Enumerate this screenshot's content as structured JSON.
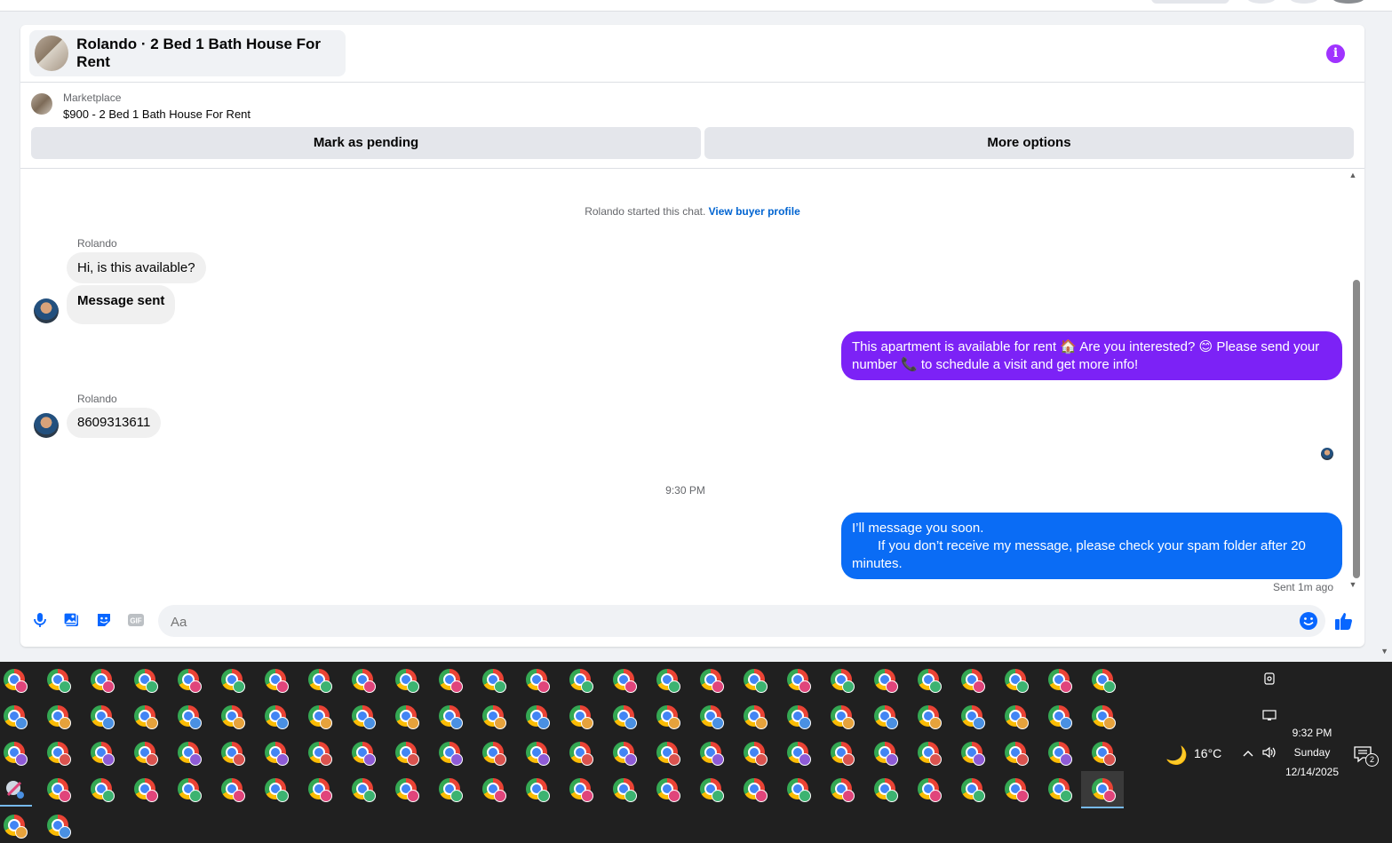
{
  "chat": {
    "title": "Rolando · 2 Bed 1 Bath House For Rent",
    "listing": {
      "source": "Marketplace",
      "price_title": "$900 - 2 Bed 1 Bath House For Rent"
    },
    "actions": {
      "mark_pending": "Mark as pending",
      "more_options": "More options"
    },
    "started_text": "Rolando started this chat.",
    "view_buyer_profile": "View buyer profile",
    "messages": [
      {
        "sender": "Rolando",
        "text": "Hi, is this available?"
      },
      {
        "text": "Message sent"
      },
      {
        "sender": "me",
        "text": "This apartment is available for rent 🏠 Are you interested? 😊 Please send your number 📞 to schedule a visit and get more info!"
      },
      {
        "sender": "Rolando",
        "text": "8609313611"
      },
      {
        "sender": "me",
        "line1": "I’ll message you soon.",
        "line2": "If you don’t receive my message, please check your spam folder after 20",
        "line3": "minutes."
      }
    ],
    "timestamp": "9:30 PM",
    "sent_status": "Sent 1m ago",
    "composer": {
      "placeholder": "Aa",
      "value": ""
    },
    "colors": {
      "purple_bubble": "#7c22f6",
      "blue_bubble": "#0a6cf5",
      "accent": "#0084ff",
      "info": "#a033ff"
    }
  },
  "taskbar": {
    "weather_temp": "16°C",
    "clock_time": "9:32 PM",
    "clock_day": "Sunday",
    "clock_date": "12/14/2025",
    "notification_count": "2"
  }
}
